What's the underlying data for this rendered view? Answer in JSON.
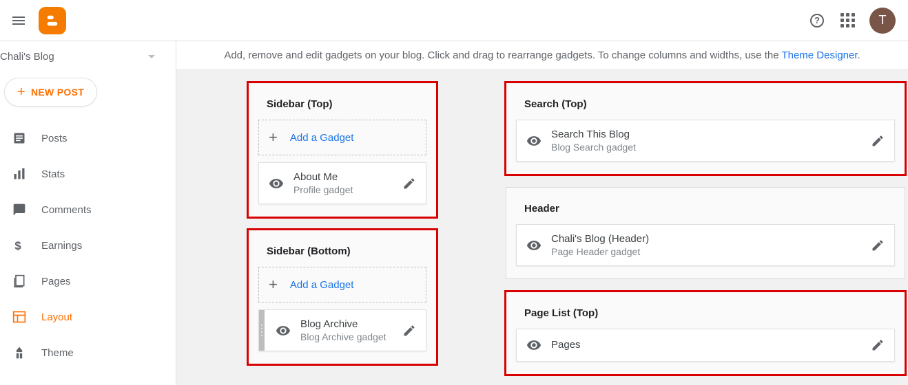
{
  "topbar": {
    "avatar_initial": "T"
  },
  "sidebar_nav": {
    "blog_name": "Chali's Blog",
    "new_post_label": "NEW POST",
    "items": [
      {
        "label": "Posts"
      },
      {
        "label": "Stats"
      },
      {
        "label": "Comments"
      },
      {
        "label": "Earnings"
      },
      {
        "label": "Pages"
      },
      {
        "label": "Layout"
      },
      {
        "label": "Theme"
      }
    ]
  },
  "content": {
    "instruction_prefix": "Add, remove and edit gadgets on your blog. Click and drag to rearrange gadgets. To change columns and widths, use the ",
    "instruction_link": "Theme Designer",
    "instruction_suffix": ".",
    "add_gadget_label": "Add a Gadget",
    "sections": {
      "sidebar_top": {
        "title": "Sidebar (Top)",
        "gadget": {
          "title": "About Me",
          "sub": "Profile gadget"
        }
      },
      "sidebar_bottom": {
        "title": "Sidebar (Bottom)",
        "gadget": {
          "title": "Blog Archive",
          "sub": "Blog Archive gadget"
        }
      },
      "search_top": {
        "title": "Search (Top)",
        "gadget": {
          "title": "Search This Blog",
          "sub": "Blog Search gadget"
        }
      },
      "header": {
        "title": "Header",
        "gadget": {
          "title": "Chali's Blog (Header)",
          "sub": "Page Header gadget"
        }
      },
      "pagelist_top": {
        "title": "Page List (Top)",
        "gadget": {
          "title": "Pages",
          "sub": ""
        }
      }
    }
  }
}
